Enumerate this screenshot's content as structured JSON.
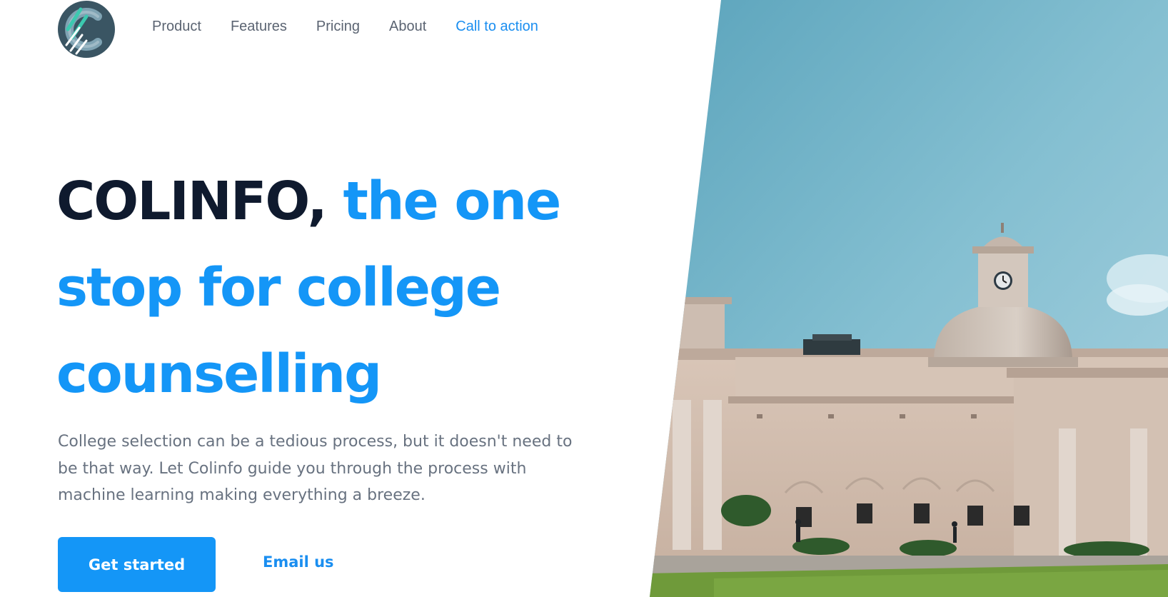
{
  "header": {
    "logo_icon": "colinfo-logo-icon",
    "nav": [
      {
        "label": "Product"
      },
      {
        "label": "Features"
      },
      {
        "label": "Pricing"
      },
      {
        "label": "About"
      },
      {
        "label": "Call to action"
      }
    ]
  },
  "hero": {
    "headline_brand": "COLINFO,",
    "headline_accent": "the one stop for college counselling",
    "description": "College selection can be a tedious process, but it doesn't need to be that way. Let Colinfo guide you through the process with machine learning making everything a breeze.",
    "primary_button": "Get started",
    "secondary_link": "Email us",
    "image_icon": "campus-building-photo"
  },
  "colors": {
    "accent": "#1496f7",
    "headline_dark": "#0f1a2e",
    "body_text": "#687280",
    "nav_text": "#5b6472",
    "logo_bg": "#3a5563",
    "logo_teal": "#3cc9b0"
  }
}
